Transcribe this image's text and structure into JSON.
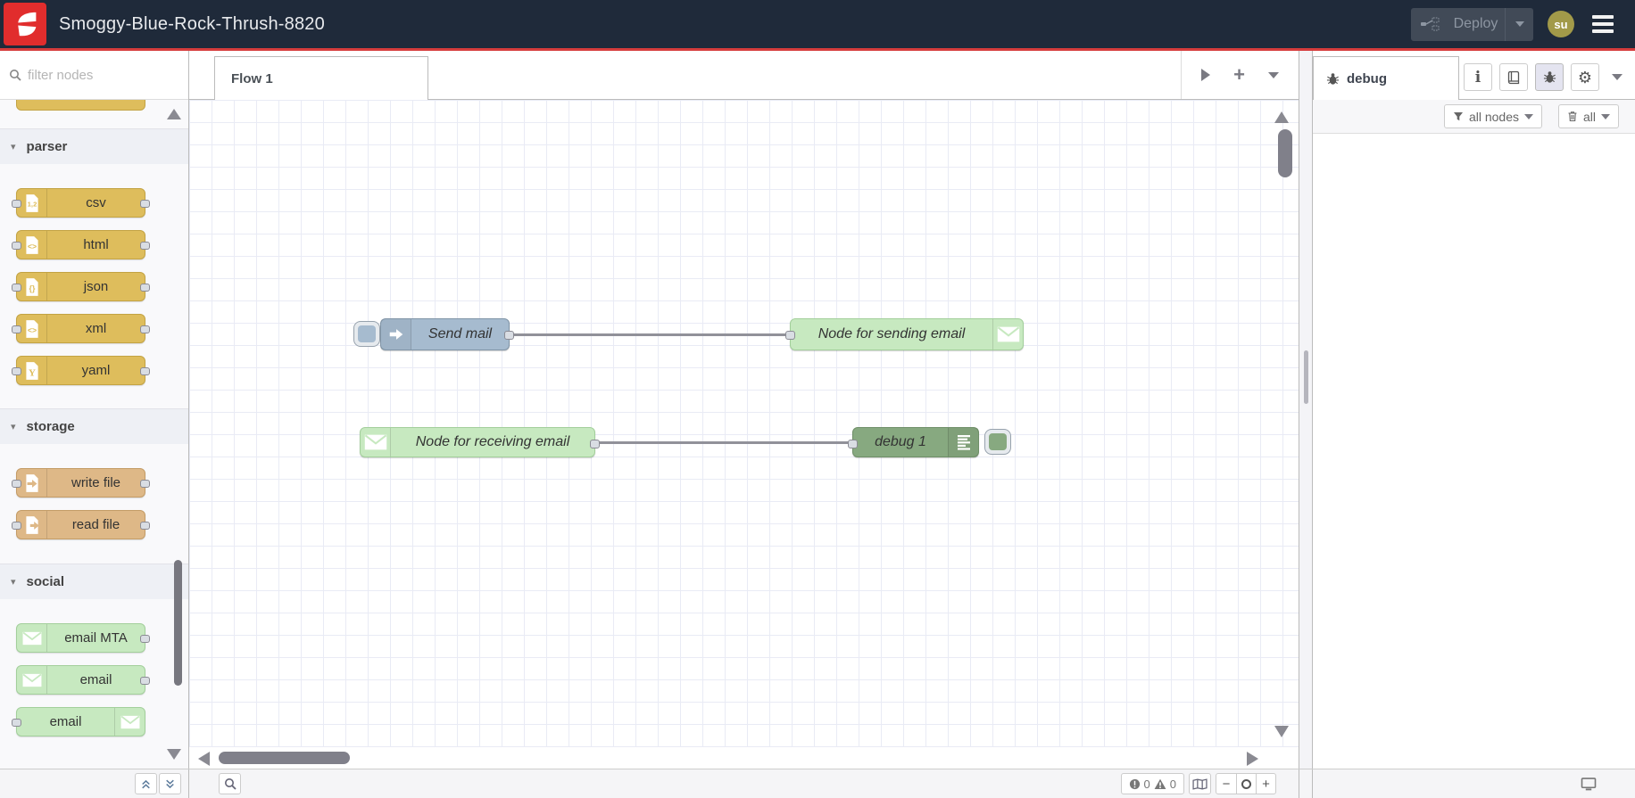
{
  "header": {
    "title": "Smoggy-Blue-Rock-Thrush-8820",
    "deploy_label": "Deploy",
    "avatar_label": "su"
  },
  "palette": {
    "filter_placeholder": "filter nodes",
    "categories": [
      {
        "label": "parser",
        "nodes": [
          {
            "label": "csv",
            "icon": "file-csv-icon",
            "glyph": "1,2",
            "ports": "both"
          },
          {
            "label": "html",
            "icon": "file-html-icon",
            "glyph": "<>",
            "ports": "both"
          },
          {
            "label": "json",
            "icon": "file-json-icon",
            "glyph": "{}",
            "ports": "both"
          },
          {
            "label": "xml",
            "icon": "file-xml-icon",
            "glyph": "<>",
            "ports": "both"
          },
          {
            "label": "yaml",
            "icon": "file-yaml-icon",
            "glyph": "Y",
            "ports": "both"
          }
        ]
      },
      {
        "label": "storage",
        "nodes": [
          {
            "label": "write file",
            "icon": "file-write-icon",
            "ports": "both"
          },
          {
            "label": "read file",
            "icon": "file-read-icon",
            "ports": "both"
          }
        ]
      },
      {
        "label": "social",
        "nodes": [
          {
            "label": "email MTA",
            "icon": "envelope-icon",
            "ports": "out"
          },
          {
            "label": "email",
            "icon": "envelope-icon",
            "ports": "out"
          },
          {
            "label": "email",
            "icon": "envelope-icon",
            "ports": "in"
          }
        ]
      }
    ]
  },
  "workspace": {
    "tabs": [
      {
        "label": "Flow 1"
      }
    ],
    "nodes": [
      {
        "label": "Send mail",
        "type": "inject"
      },
      {
        "label": "Node for sending email",
        "type": "email-out"
      },
      {
        "label": "Node for receiving email",
        "type": "email-in"
      },
      {
        "label": "debug 1",
        "type": "debug"
      }
    ],
    "wires": [
      {
        "from": "Send mail",
        "to": "Node for sending email"
      },
      {
        "from": "Node for receiving email",
        "to": "debug 1"
      }
    ]
  },
  "sidebar": {
    "tab_label": "debug",
    "filter_button_label": "all nodes",
    "clear_button_label": "all"
  },
  "statusbar": {
    "error_count": "0",
    "warning_count": "0"
  },
  "icons": {
    "gear": "⚙",
    "plus": "+",
    "minus": "−"
  },
  "colors": {
    "header_bg": "#1f2a3a",
    "accent_red": "#d63c3c",
    "logo_red": "#e12d2d",
    "avatar_bg": "#a29a49",
    "inject": "#a6bbcf",
    "parser": "#debd5c",
    "storage": "#deb887",
    "email": "#c7e9c0",
    "debug": "#87a980"
  }
}
